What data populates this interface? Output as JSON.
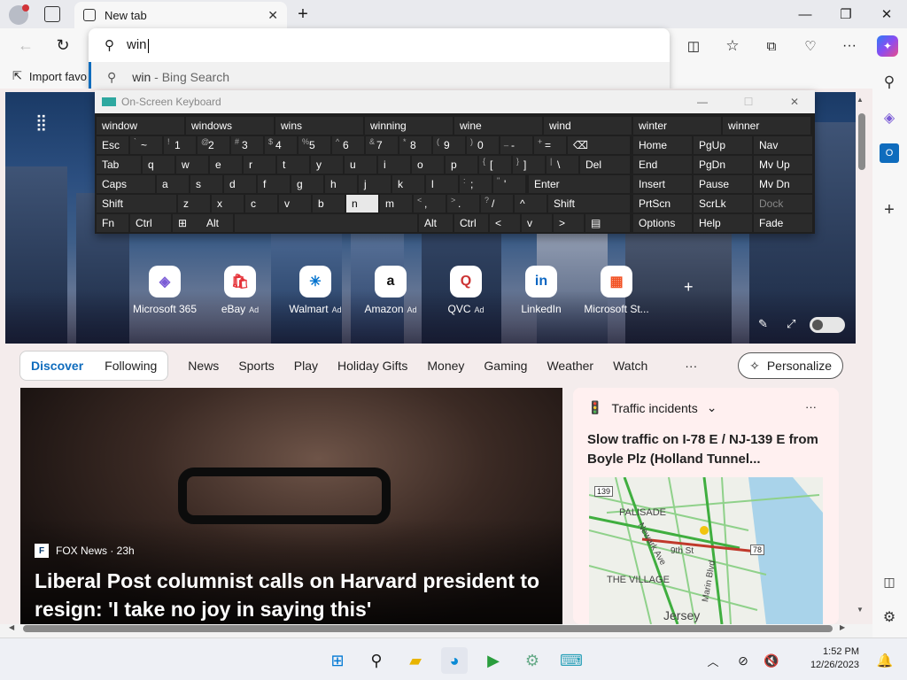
{
  "browser": {
    "tab_title": "New tab",
    "new_tab_symbol": "+",
    "omnibox_value": "win",
    "suggestion_term": "win",
    "suggestion_source": " - Bing Search",
    "fav_import": "Import favo",
    "accent": "#0f6cbd"
  },
  "osk": {
    "title": "On-Screen Keyboard",
    "predictions": [
      "window",
      "windows",
      "wins",
      "winning",
      "wine",
      "wind",
      "winter",
      "winner"
    ],
    "rows": [
      [
        {
          "m": "Esc"
        },
        {
          "m": "~",
          "s": "`"
        },
        {
          "m": "1",
          "s": "!"
        },
        {
          "m": "2",
          "s": "@"
        },
        {
          "m": "3",
          "s": "#"
        },
        {
          "m": "4",
          "s": "$"
        },
        {
          "m": "5",
          "s": "%"
        },
        {
          "m": "6",
          "s": "^"
        },
        {
          "m": "7",
          "s": "&"
        },
        {
          "m": "8",
          "s": "*"
        },
        {
          "m": "9",
          "s": "("
        },
        {
          "m": "0",
          "s": ")"
        },
        {
          "m": "-",
          "s": "_"
        },
        {
          "m": "=",
          "s": "+"
        },
        {
          "m": "⌫"
        }
      ],
      [
        {
          "m": "Tab"
        },
        {
          "m": "q"
        },
        {
          "m": "w"
        },
        {
          "m": "e"
        },
        {
          "m": "r"
        },
        {
          "m": "t"
        },
        {
          "m": "y"
        },
        {
          "m": "u"
        },
        {
          "m": "i"
        },
        {
          "m": "o"
        },
        {
          "m": "p"
        },
        {
          "m": "[",
          "s": "{"
        },
        {
          "m": "]",
          "s": "}"
        },
        {
          "m": "\\",
          "s": "|"
        },
        {
          "m": "Del"
        }
      ],
      [
        {
          "m": "Caps"
        },
        {
          "m": "a"
        },
        {
          "m": "s"
        },
        {
          "m": "d"
        },
        {
          "m": "f"
        },
        {
          "m": "g"
        },
        {
          "m": "h"
        },
        {
          "m": "j"
        },
        {
          "m": "k"
        },
        {
          "m": "l"
        },
        {
          "m": ";",
          "s": ":"
        },
        {
          "m": "'",
          "s": "\""
        },
        {
          "m": "Enter"
        }
      ],
      [
        {
          "m": "Shift"
        },
        {
          "m": "z"
        },
        {
          "m": "x"
        },
        {
          "m": "c"
        },
        {
          "m": "v"
        },
        {
          "m": "b"
        },
        {
          "m": "n"
        },
        {
          "m": "m"
        },
        {
          "m": ",",
          "s": "<"
        },
        {
          "m": ".",
          "s": ">"
        },
        {
          "m": "/",
          "s": "?"
        },
        {
          "m": "^"
        },
        {
          "m": "Shift"
        }
      ],
      [
        {
          "m": "Fn"
        },
        {
          "m": "Ctrl"
        },
        {
          "m": "⊞"
        },
        {
          "m": "Alt"
        },
        {
          "m": ""
        },
        {
          "m": "Alt"
        },
        {
          "m": "Ctrl"
        },
        {
          "m": "<"
        },
        {
          "m": "v"
        },
        {
          "m": ">"
        },
        {
          "m": "▤"
        }
      ]
    ],
    "nav_keys": [
      [
        "Home",
        "PgUp",
        "Nav"
      ],
      [
        "End",
        "PgDn",
        "Mv Up"
      ],
      [
        "Insert",
        "Pause",
        "Mv Dn"
      ],
      [
        "PrtScn",
        "ScrLk",
        "Dock"
      ],
      [
        "Options",
        "Help",
        "Fade"
      ]
    ]
  },
  "sites": [
    {
      "label": "Microsoft 365",
      "ad": "",
      "icon": "m365-icon",
      "glyph": "◈",
      "color": "#7b5cd6"
    },
    {
      "label": "eBay",
      "ad": "Ad",
      "icon": "ebay-icon",
      "glyph": "🛍",
      "color": "#e53238"
    },
    {
      "label": "Walmart",
      "ad": "Ad",
      "icon": "walmart-icon",
      "glyph": "✳",
      "color": "#0071ce"
    },
    {
      "label": "Amazon",
      "ad": "Ad",
      "icon": "amazon-icon",
      "glyph": "a",
      "color": "#111"
    },
    {
      "label": "QVC",
      "ad": "Ad",
      "icon": "qvc-icon",
      "glyph": "Q",
      "color": "#c33"
    },
    {
      "label": "LinkedIn",
      "ad": "",
      "icon": "linkedin-icon",
      "glyph": "in",
      "color": "#0a66c2"
    },
    {
      "label": "Microsoft St...",
      "ad": "",
      "icon": "ms-store-icon",
      "glyph": "▦",
      "color": "#f25022"
    }
  ],
  "feed": {
    "pill": [
      "Discover",
      "Following"
    ],
    "tabs": [
      "News",
      "Sports",
      "Play",
      "Holiday Gifts",
      "Money",
      "Gaming",
      "Weather",
      "Watch"
    ],
    "more": "···",
    "personalize": "Personalize"
  },
  "main_story": {
    "source": "FOX News · 23h",
    "headline": "Liberal Post columnist calls on Harvard president to resign: 'I take no joy in saying this'"
  },
  "traffic": {
    "title": "Traffic incidents",
    "more": "···",
    "text": "Slow traffic on I-78 E / NJ-139 E from Boyle Plz (Holland Tunnel...",
    "map_labels": [
      "139",
      "PALISADE",
      "Newark Ave",
      "9th St",
      "78",
      "THE VILLAGE",
      "Marin Blvd",
      "Jersey"
    ]
  },
  "taskbar": {
    "time": "1:52 PM",
    "date": "12/26/2023"
  }
}
